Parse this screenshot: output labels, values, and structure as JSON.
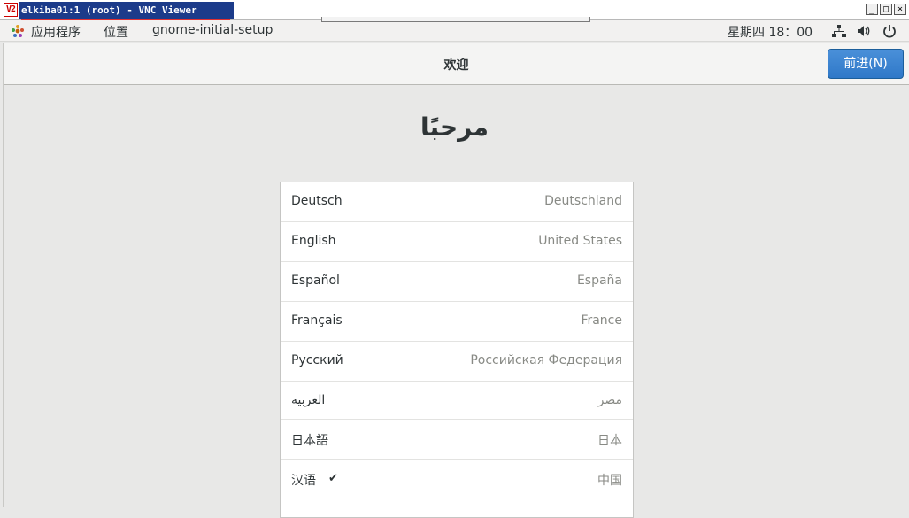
{
  "vnc": {
    "title": "elkiba01:1 (root) - VNC Viewer",
    "logo": "V2",
    "controls": [
      "_",
      "□",
      "×"
    ]
  },
  "panel": {
    "applications": "应用程序",
    "places": "位置",
    "app_name": "gnome-initial-setup",
    "clock": "星期四 18：00",
    "icons": [
      "network-icon",
      "volume-icon",
      "power-icon"
    ]
  },
  "header": {
    "title": "欢迎",
    "next_label": "前进(N)"
  },
  "welcome": "مرحبًا",
  "languages": [
    {
      "name": "Deutsch",
      "region": "Deutschland"
    },
    {
      "name": "English",
      "region": "United States"
    },
    {
      "name": "Español",
      "region": "España"
    },
    {
      "name": "Français",
      "region": "France"
    },
    {
      "name": "Русский",
      "region": "Российская Федерация"
    },
    {
      "name": "العربية",
      "region": "مصر"
    },
    {
      "name": "日本語",
      "region": "日本"
    },
    {
      "name": "汉语",
      "region": "中国",
      "selected": true,
      "check": "✔"
    }
  ],
  "colors": {
    "accent": "#3584e4",
    "vnc_title_bg": "#1c3b8a"
  }
}
